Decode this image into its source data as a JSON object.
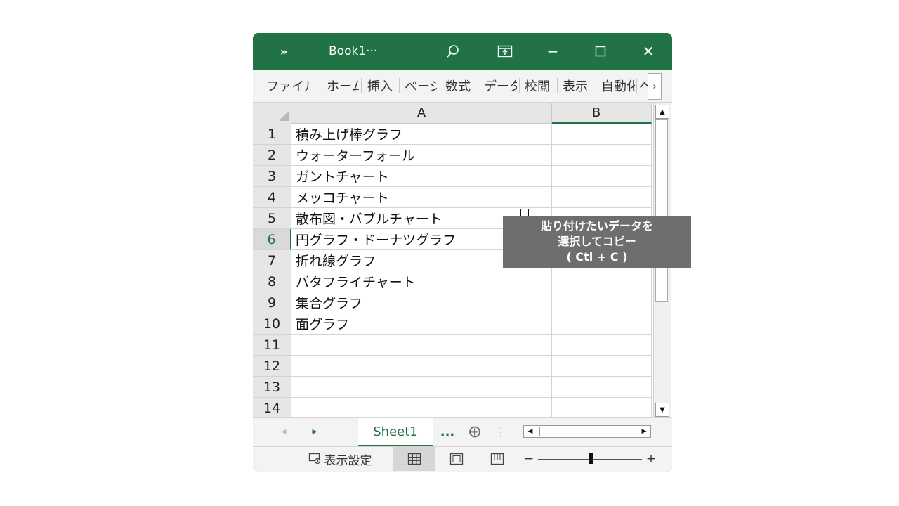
{
  "titlebar": {
    "expand_icon": "»",
    "title": "Book1···",
    "icons": [
      "search-icon",
      "ribbon-display-icon",
      "minimize-icon",
      "maximize-icon",
      "close-icon"
    ],
    "min_glyph": "−",
    "close_glyph": "✕"
  },
  "ribbon": {
    "tabs": [
      {
        "label": "ファイル"
      },
      {
        "label": "ホーム"
      },
      {
        "label": "挿入"
      },
      {
        "label": "ページ"
      },
      {
        "label": "数式"
      },
      {
        "label": "データ"
      },
      {
        "label": "校閲"
      },
      {
        "label": "表示"
      },
      {
        "label": "自動化"
      },
      {
        "label": "ヘ"
      }
    ],
    "more_glyph": "›"
  },
  "grid": {
    "columns": [
      "A",
      "B"
    ],
    "rows": [
      {
        "num": "1",
        "a": "積み上げ棒グラフ"
      },
      {
        "num": "2",
        "a": "ウォーターフォール"
      },
      {
        "num": "3",
        "a": "ガントチャート"
      },
      {
        "num": "4",
        "a": "メッコチャート"
      },
      {
        "num": "5",
        "a": "散布図・バブルチャート"
      },
      {
        "num": "6",
        "a": "円グラフ・ドーナツグラフ"
      },
      {
        "num": "7",
        "a": "折れ線グラフ"
      },
      {
        "num": "8",
        "a": "バタフライチャート"
      },
      {
        "num": "9",
        "a": "集合グラフ"
      },
      {
        "num": "10",
        "a": "面グラフ"
      },
      {
        "num": "11",
        "a": ""
      },
      {
        "num": "12",
        "a": ""
      },
      {
        "num": "13",
        "a": ""
      },
      {
        "num": "14",
        "a": ""
      }
    ],
    "active_row": "6"
  },
  "tooltip": {
    "line1": "貼り付けたいデータを",
    "line2": "選択してコピー",
    "line3": "( Ctl + C )"
  },
  "sheetbar": {
    "nav_prev": "◂",
    "nav_next": "▸",
    "sheet_name": "Sheet1",
    "ellipsis": "...",
    "add_glyph": "⊕",
    "grip_glyph": "⋮"
  },
  "statusbar": {
    "display_settings": "表示設定",
    "zoom_minus": "−",
    "zoom_plus": "+"
  },
  "colors": {
    "accent": "#217346",
    "tooltip_bg": "#6e6e6e"
  }
}
